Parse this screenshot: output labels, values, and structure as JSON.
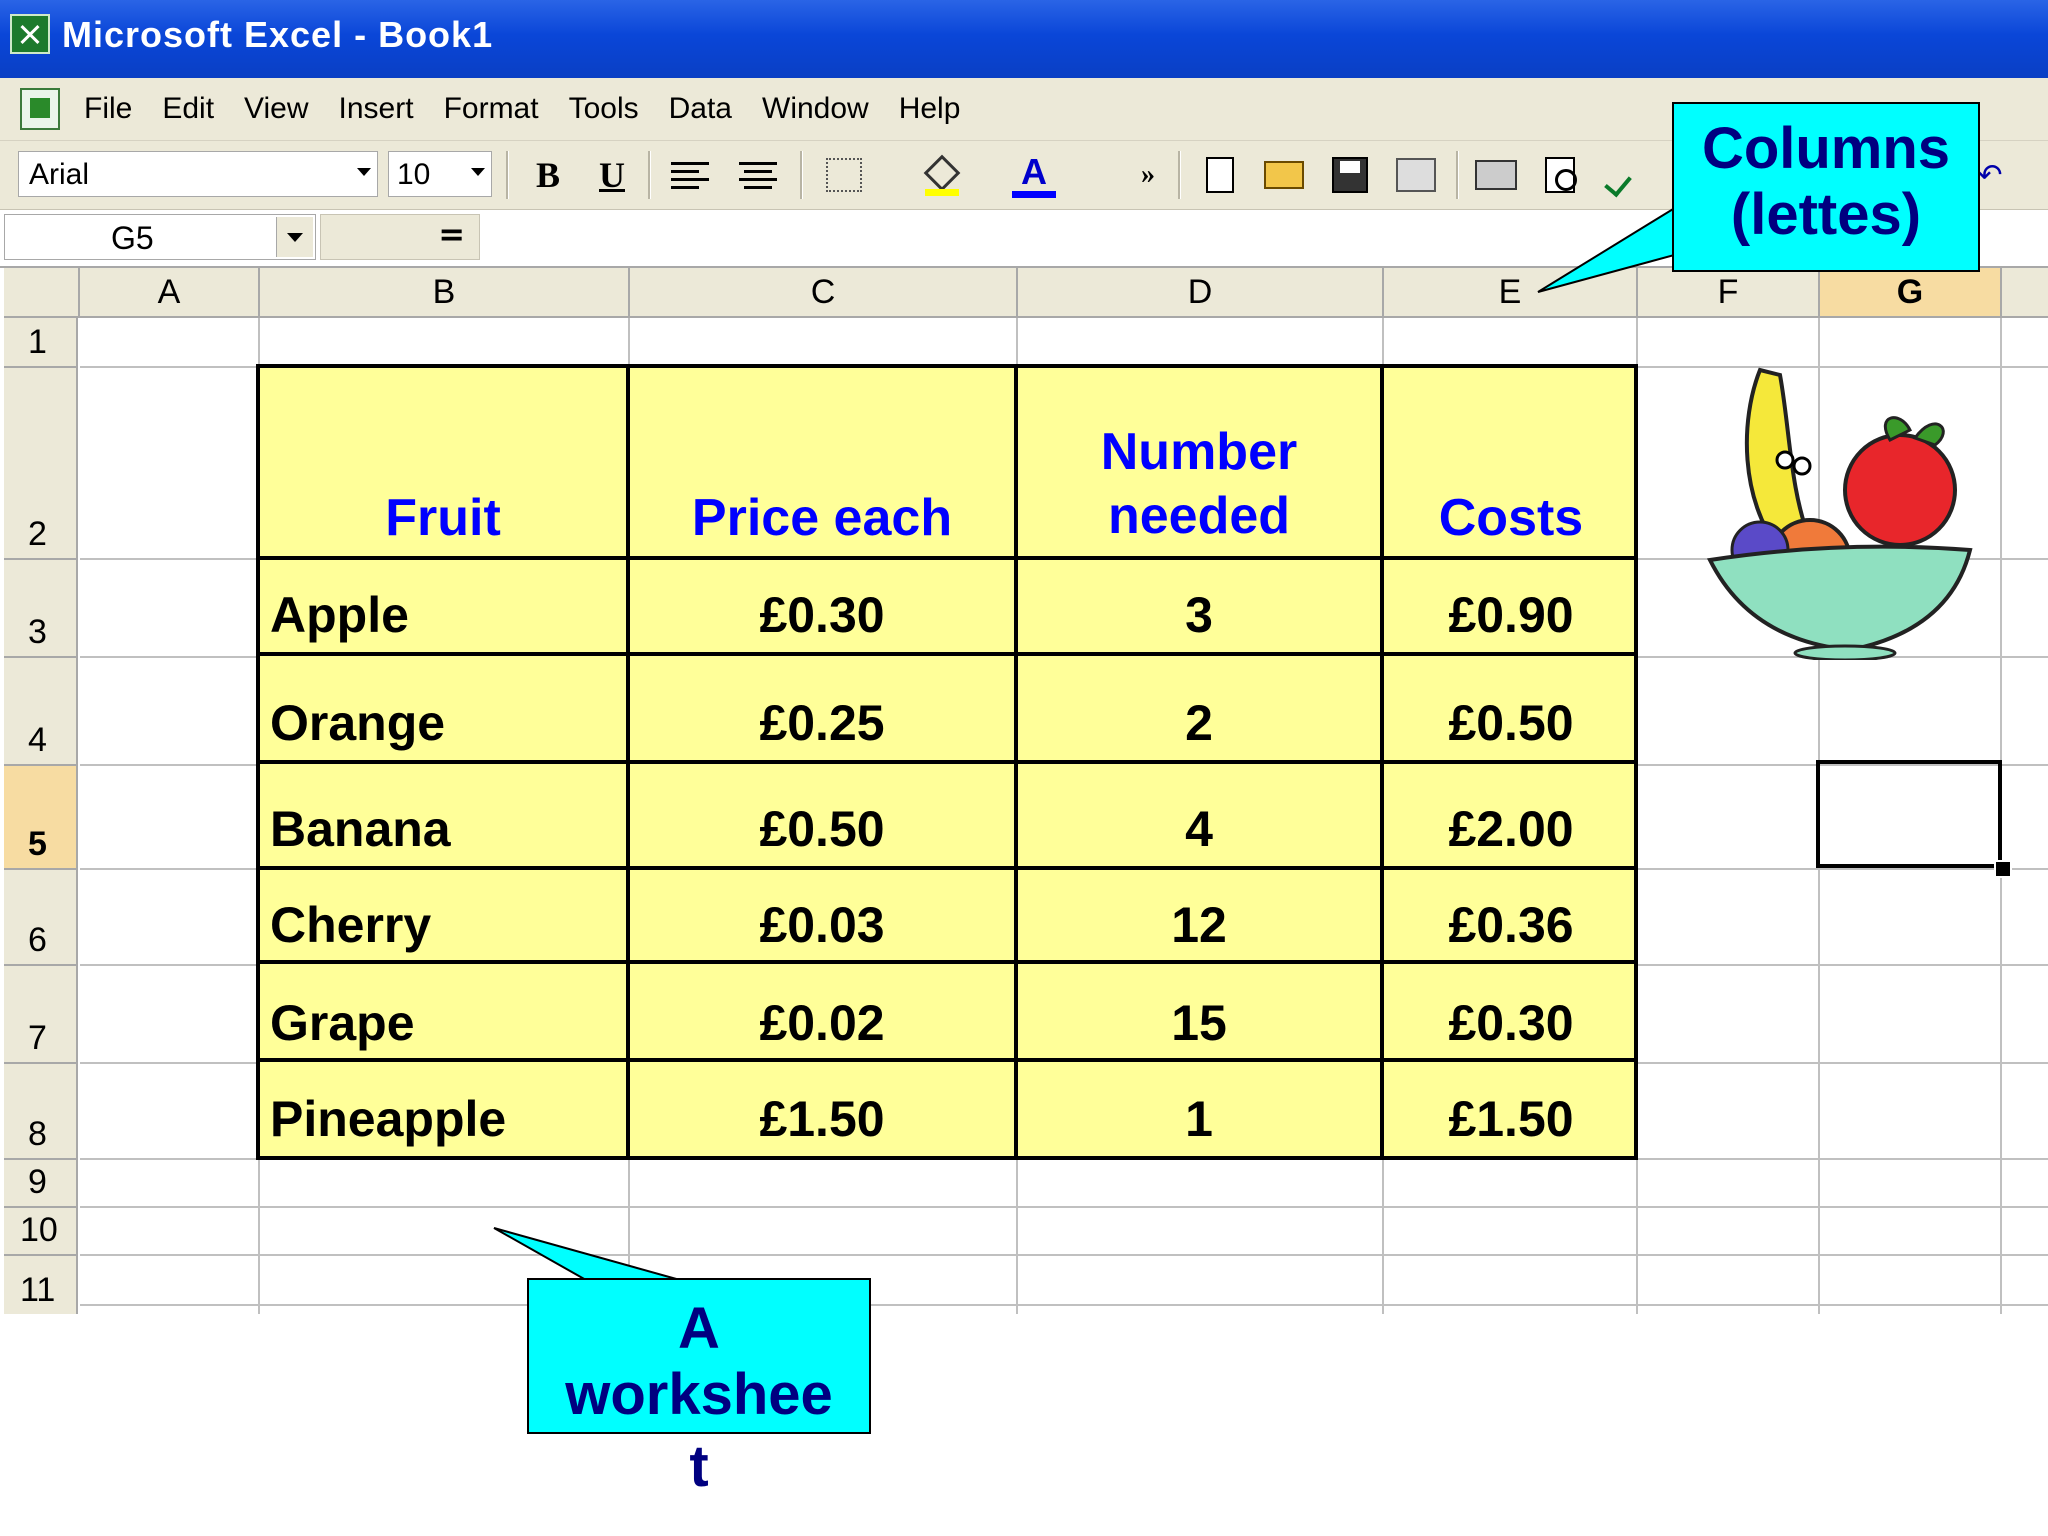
{
  "window": {
    "title": "Microsoft Excel - Book1"
  },
  "menu": [
    "File",
    "Edit",
    "View",
    "Insert",
    "Format",
    "Tools",
    "Data",
    "Window",
    "Help"
  ],
  "toolbar": {
    "font": "Arial",
    "size": "10",
    "bold": "B",
    "underline": "U",
    "font_color_glyph": "A",
    "more": "»"
  },
  "formula_bar": {
    "name_box": "G5",
    "equals": "="
  },
  "columns": [
    "A",
    "B",
    "C",
    "D",
    "E",
    "F",
    "G"
  ],
  "rows": [
    "1",
    "2",
    "3",
    "4",
    "5",
    "6",
    "7",
    "8",
    "9",
    "10",
    "11"
  ],
  "table": {
    "headers": [
      "Fruit",
      "Price each",
      "Number\nneeded",
      "Costs"
    ],
    "rows": [
      {
        "fruit": "Apple",
        "price": "£0.30",
        "number": "3",
        "cost": "£0.90"
      },
      {
        "fruit": "Orange",
        "price": "£0.25",
        "number": "2",
        "cost": "£0.50"
      },
      {
        "fruit": "Banana",
        "price": "£0.50",
        "number": "4",
        "cost": "£2.00"
      },
      {
        "fruit": "Cherry",
        "price": "£0.03",
        "number": "12",
        "cost": "£0.36"
      },
      {
        "fruit": "Grape",
        "price": "£0.02",
        "number": "15",
        "cost": "£0.30"
      },
      {
        "fruit": "Pineapple",
        "price": "£1.50",
        "number": "1",
        "cost": "£1.50"
      }
    ]
  },
  "callouts": {
    "columns": "Columns\n(lettes)",
    "worksheet_line1": "A",
    "worksheet_line2": "workshee",
    "worksheet_line3": "t"
  },
  "colors": {
    "table_fill": "#ffff99",
    "header_text": "#0000ff",
    "callout_fill": "#00ffff",
    "callout_text": "#000080",
    "title_bar": "#0a46d8"
  }
}
